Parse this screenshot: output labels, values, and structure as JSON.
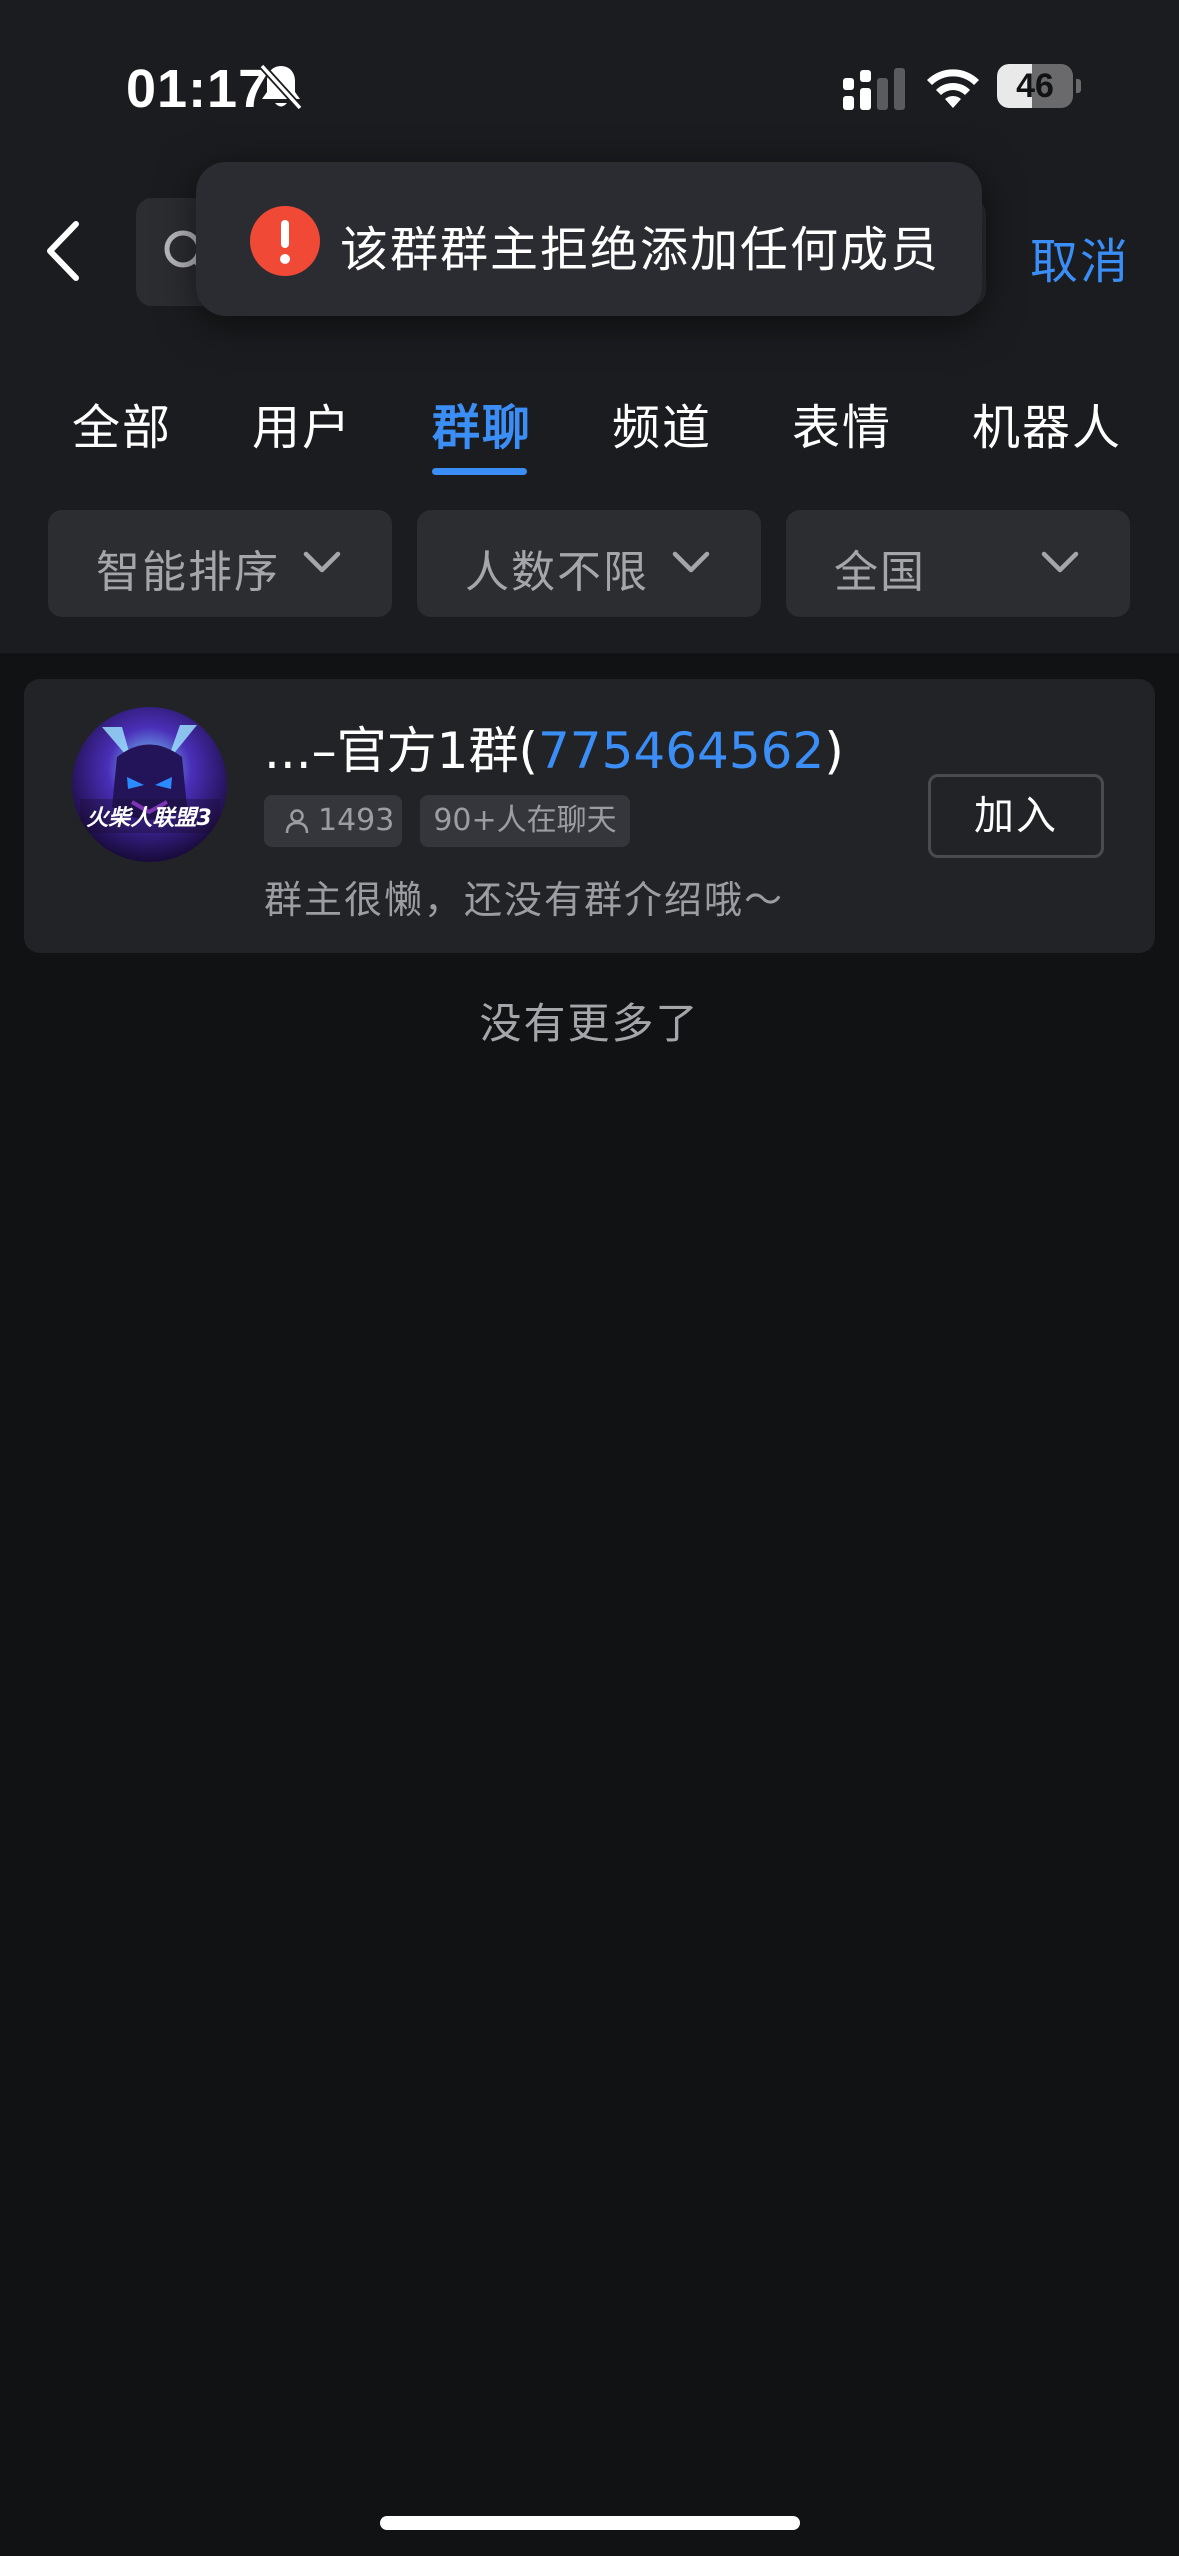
{
  "status_bar": {
    "time": "01:17",
    "battery_level": 46,
    "battery_label": "46",
    "icons": [
      "bell-slash-icon",
      "cellular-signal-icon",
      "wifi-icon",
      "battery-icon"
    ]
  },
  "header": {
    "back_icon": "chevron-left-icon",
    "search_icon": "search-icon",
    "search_value": "",
    "cancel_label": "取消"
  },
  "toast": {
    "icon": "exclamation-icon",
    "message": "该群群主拒绝添加任何成员",
    "icon_color": "#f04a37"
  },
  "tabs": [
    {
      "label": "全部",
      "active": false
    },
    {
      "label": "用户",
      "active": false
    },
    {
      "label": "群聊",
      "active": true
    },
    {
      "label": "频道",
      "active": false
    },
    {
      "label": "表情",
      "active": false
    },
    {
      "label": "机器人",
      "active": false
    }
  ],
  "filters": [
    {
      "label": "智能排序"
    },
    {
      "label": "人数不限"
    },
    {
      "label": "全国"
    }
  ],
  "results": [
    {
      "name_prefix": "...–官方1群(",
      "group_id": "775464562",
      "name_suffix": ")",
      "member_count": "1493",
      "active_badge": "90+人在聊天",
      "description": "群主很懒，还没有群介绍哦～",
      "join_label": "加入",
      "avatar_text": "火柴人联盟3"
    }
  ],
  "footer_text": "没有更多了",
  "colors": {
    "accent": "#3a8ef6",
    "background": "#111214",
    "header_background": "#1b1c1f",
    "card_background": "#222327"
  }
}
